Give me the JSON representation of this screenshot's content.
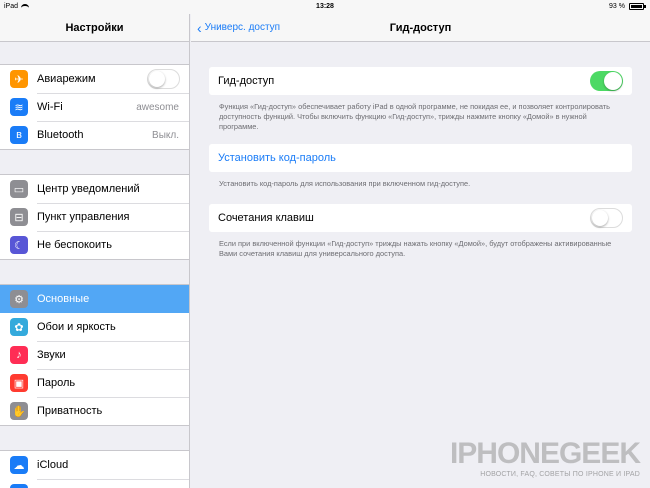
{
  "statusbar": {
    "device": "iPad",
    "time": "13:28",
    "battery": "93 %"
  },
  "sidebar": {
    "title": "Настройки",
    "groups": [
      [
        {
          "label": "Авиарежим",
          "icon": "airplane-icon",
          "color": "#ff9500",
          "glyph": "✈",
          "accessory": "toggle-off"
        },
        {
          "label": "Wi-Fi",
          "icon": "wifi-icon",
          "color": "#1a7cf7",
          "glyph": "≋",
          "value": "awesome"
        },
        {
          "label": "Bluetooth",
          "icon": "bluetooth-icon",
          "color": "#1a7cf7",
          "glyph": "ʙ",
          "value": "Выкл."
        }
      ],
      [
        {
          "label": "Центр уведомлений",
          "icon": "notifications-icon",
          "color": "#8e8e93",
          "glyph": "▭"
        },
        {
          "label": "Пункт управления",
          "icon": "control-center-icon",
          "color": "#8e8e93",
          "glyph": "⊟"
        },
        {
          "label": "Не беспокоить",
          "icon": "moon-icon",
          "color": "#5856d6",
          "glyph": "☾"
        }
      ],
      [
        {
          "label": "Основные",
          "icon": "gear-icon",
          "color": "#8e8e93",
          "glyph": "⚙",
          "selected": true
        },
        {
          "label": "Обои и яркость",
          "icon": "wallpaper-icon",
          "color": "#34aadc",
          "glyph": "✿"
        },
        {
          "label": "Звуки",
          "icon": "sound-icon",
          "color": "#ff2d55",
          "glyph": "♪"
        },
        {
          "label": "Пароль",
          "icon": "lock-icon",
          "color": "#ff3b30",
          "glyph": "▣"
        },
        {
          "label": "Приватность",
          "icon": "hand-icon",
          "color": "#8e8e93",
          "glyph": "✋"
        }
      ],
      [
        {
          "label": "iCloud",
          "icon": "cloud-icon",
          "color": "#1a7cf7",
          "glyph": "☁"
        },
        {
          "label": "Почта, адреса, календари",
          "icon": "mail-icon",
          "color": "#1a7cf7",
          "glyph": "✉"
        }
      ]
    ]
  },
  "nav": {
    "back_label": "Универс. доступ",
    "title": "Гид-доступ"
  },
  "main": {
    "guided_access": {
      "label": "Гид-доступ",
      "state": "on",
      "footnote": "Функция «Гид-доступ» обеспечивает работу iPad в одной программе, не покидая ее, и позволяет контролировать доступность функций. Чтобы включить функцию «Гид-доступ», трижды нажмите кнопку «Домой» в нужной программе."
    },
    "passcode": {
      "label": "Установить код-пароль",
      "footnote": "Установить код-пароль для использования при включенном гид-доступе."
    },
    "shortcuts": {
      "label": "Сочетания клавиш",
      "state": "off",
      "footnote": "Если при включенной функции «Гид-доступ» трижды нажать кнопку «Домой», будут отображены активированные Вами сочетания клавиш для универсального доступа."
    }
  },
  "watermark": {
    "title": "IPHONEGEEK",
    "subtitle": "НОВОСТИ, FAQ, СОВЕТЫ ПО IPHONE И IPAD"
  },
  "colors": {
    "accent": "#1a7cf7",
    "selected": "#52a7f5",
    "toggle_on": "#4cd964"
  }
}
